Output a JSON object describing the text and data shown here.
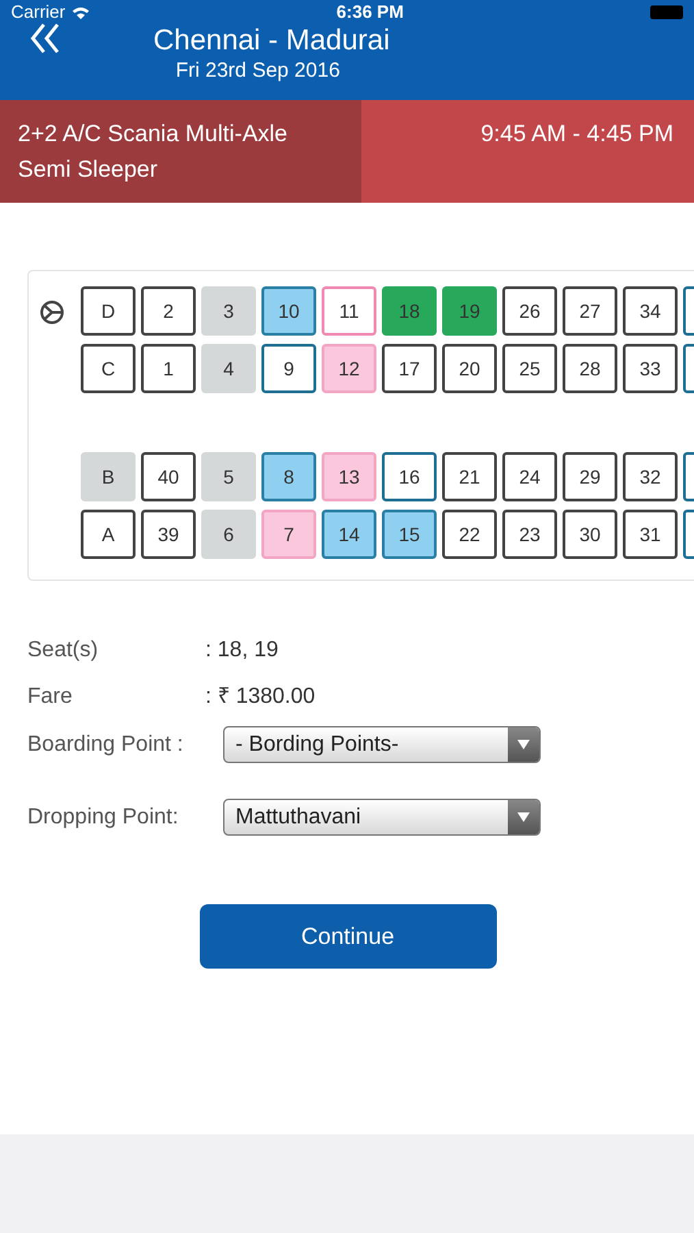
{
  "status_bar": {
    "carrier": "Carrier",
    "time": "6:36 PM"
  },
  "header": {
    "title": "Chennai - Madurai",
    "date": "Fri 23rd Sep 2016"
  },
  "bus": {
    "type": "2+2 A/C Scania Multi-Axle Semi Sleeper",
    "timing": "9:45 AM - 4:45 PM"
  },
  "seat_rows": [
    [
      {
        "label": "D",
        "kind": "white"
      },
      {
        "label": "2",
        "kind": "white"
      },
      {
        "label": "3",
        "kind": "grey"
      },
      {
        "label": "10",
        "kind": "blue"
      },
      {
        "label": "11",
        "kind": "pinkoutline"
      },
      {
        "label": "18",
        "kind": "green"
      },
      {
        "label": "19",
        "kind": "green"
      },
      {
        "label": "26",
        "kind": "white"
      },
      {
        "label": "27",
        "kind": "white"
      },
      {
        "label": "34",
        "kind": "white"
      },
      {
        "kind": "blueoutline"
      }
    ],
    [
      {
        "label": "C",
        "kind": "white"
      },
      {
        "label": "1",
        "kind": "white"
      },
      {
        "label": "4",
        "kind": "grey"
      },
      {
        "label": "9",
        "kind": "blueoutline"
      },
      {
        "label": "12",
        "kind": "pink"
      },
      {
        "label": "17",
        "kind": "white"
      },
      {
        "label": "20",
        "kind": "white"
      },
      {
        "label": "25",
        "kind": "white"
      },
      {
        "label": "28",
        "kind": "white"
      },
      {
        "label": "33",
        "kind": "white"
      },
      {
        "kind": "blueoutline"
      }
    ],
    [
      {
        "label": "B",
        "kind": "grey"
      },
      {
        "label": "40",
        "kind": "white"
      },
      {
        "label": "5",
        "kind": "grey"
      },
      {
        "label": "8",
        "kind": "blue"
      },
      {
        "label": "13",
        "kind": "pink"
      },
      {
        "label": "16",
        "kind": "blueoutline"
      },
      {
        "label": "21",
        "kind": "white"
      },
      {
        "label": "24",
        "kind": "white"
      },
      {
        "label": "29",
        "kind": "white"
      },
      {
        "label": "32",
        "kind": "white"
      },
      {
        "kind": "blueoutline"
      }
    ],
    [
      {
        "label": "A",
        "kind": "white"
      },
      {
        "label": "39",
        "kind": "white"
      },
      {
        "label": "6",
        "kind": "grey"
      },
      {
        "label": "7",
        "kind": "pink"
      },
      {
        "label": "14",
        "kind": "blue"
      },
      {
        "label": "15",
        "kind": "blue"
      },
      {
        "label": "22",
        "kind": "white"
      },
      {
        "label": "23",
        "kind": "white"
      },
      {
        "label": "30",
        "kind": "white"
      },
      {
        "label": "31",
        "kind": "white"
      },
      {
        "kind": "blueoutline"
      }
    ]
  ],
  "summary": [
    {
      "label": "Seat(s)",
      "value": ": 18, 19"
    },
    {
      "label": "Fare",
      "value": ": ₹ 1380.00"
    }
  ],
  "selects": [
    {
      "label": "Boarding Point :",
      "value": "- Bording Points-"
    },
    {
      "label": "Dropping Point:",
      "value": "Mattuthavani"
    }
  ],
  "continue_button": "Continue"
}
